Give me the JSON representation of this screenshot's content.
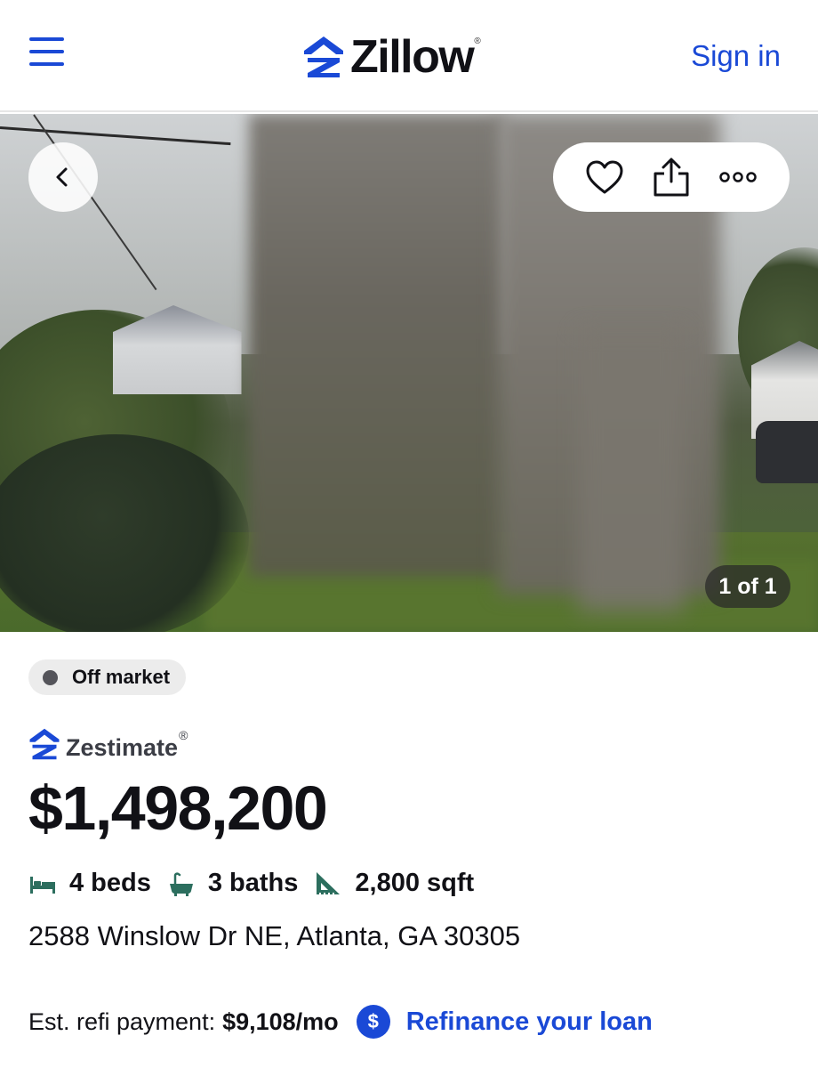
{
  "header": {
    "brand": "Zillow",
    "brand_reg": "®",
    "sign_in": "Sign in"
  },
  "photo": {
    "counter": "1 of 1"
  },
  "listing": {
    "status": "Off market",
    "zestimate_label": "Zestimate",
    "zestimate_reg": "®",
    "price": "$1,498,200",
    "beds": "4 beds",
    "baths": "3 baths",
    "sqft": "2,800 sqft",
    "address": "2588 Winslow Dr NE, Atlanta, GA 30305",
    "refi_label": "Est. refi payment:",
    "refi_amount": "$9,108/mo",
    "refi_icon": "$",
    "refi_link": "Refinance your loan"
  },
  "colors": {
    "brand_blue": "#1a49d6",
    "text_dark": "#111116",
    "feature_icon": "#2c6e5e"
  },
  "icons": [
    "menu-icon",
    "zillow-logo-icon",
    "back-chevron-icon",
    "heart-icon",
    "share-icon",
    "more-icon",
    "zestimate-logo-icon",
    "bed-icon",
    "bath-icon",
    "sqft-icon",
    "dollar-icon"
  ]
}
